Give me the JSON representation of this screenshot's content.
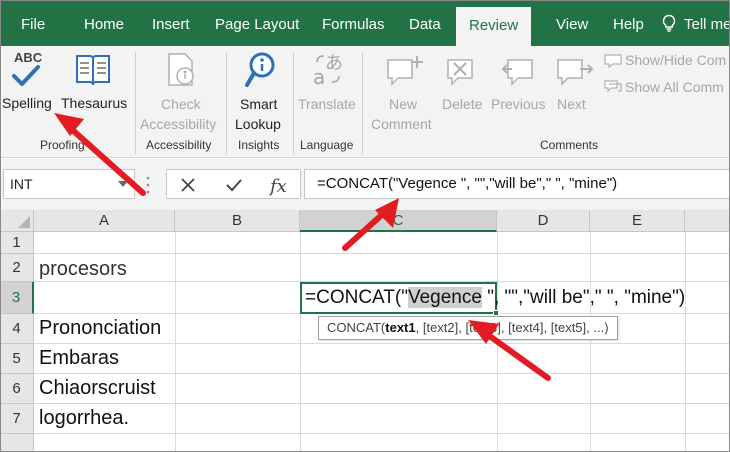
{
  "colors": {
    "accent": "#217346",
    "arrow": "#e31b23",
    "disabled": "#a6a6a6"
  },
  "tabs": [
    {
      "label": "File"
    },
    {
      "label": "Home"
    },
    {
      "label": "Insert"
    },
    {
      "label": "Page Layout"
    },
    {
      "label": "Formulas"
    },
    {
      "label": "Data"
    },
    {
      "label": "Review",
      "active": true
    },
    {
      "label": "View"
    },
    {
      "label": "Help"
    }
  ],
  "tell_me": "Tell me",
  "ribbon": {
    "proofing": {
      "label": "Proofing",
      "spelling": "Spelling",
      "thesaurus": "Thesaurus",
      "abc": "ABC"
    },
    "accessibility": {
      "label": "Accessibility",
      "check_line1": "Check",
      "check_line2": "Accessibility"
    },
    "insights": {
      "label": "Insights",
      "smart_line1": "Smart",
      "smart_line2": "Lookup"
    },
    "language": {
      "label": "Language",
      "translate": "Translate"
    },
    "comments": {
      "label": "Comments",
      "new_line1": "New",
      "new_line2": "Comment",
      "delete": "Delete",
      "previous": "Previous",
      "next": "Next",
      "show_hide": "Show/Hide Com",
      "show_all": "Show All Comm"
    }
  },
  "formula_bar": {
    "name_box": "INT",
    "fx": "fx",
    "formula": "=CONCAT(\"Vegence \", \"\",\"will be\",\" \", \"mine\")"
  },
  "grid": {
    "columns": [
      "A",
      "B",
      "C",
      "D",
      "E"
    ],
    "rows": [
      "1",
      "2",
      "3",
      "4",
      "5",
      "6",
      "7"
    ],
    "cells": {
      "A2": "procesors",
      "A4": "Prononciation",
      "A5": "Embaras",
      "A6": "Chiaorscruist",
      "A7": "logorrhea."
    },
    "edit": {
      "prefix": "=CONCAT(\"",
      "highlight": "Vegence",
      "suffix": " \", \"\",\"will be\",\" \", \"mine\")"
    },
    "tooltip": {
      "func": "CONCAT(",
      "arg1": "text1",
      "rest": ", [text2], [text3], [text4], [text5], ...)"
    }
  }
}
